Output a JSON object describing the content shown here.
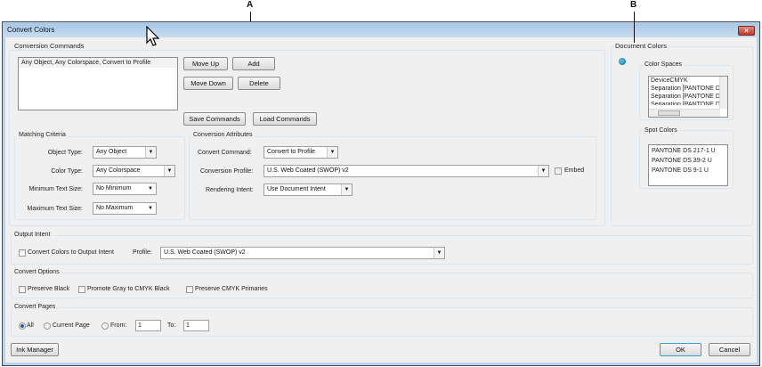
{
  "annotations": {
    "a": "A",
    "b": "B"
  },
  "window": {
    "title": "Convert Colors",
    "close_icon": "×"
  },
  "conversion_commands": {
    "label": "Conversion Commands",
    "list_items": [
      "Any Object, Any Colorspace, Convert to Profile"
    ],
    "move_up": "Move Up",
    "add": "Add",
    "move_down": "Move Down",
    "delete": "Delete",
    "save": "Save Commands",
    "load": "Load Commands"
  },
  "matching_criteria": {
    "label": "Matching Criteria",
    "object_type_label": "Object Type:",
    "object_type": "Any Object",
    "color_type_label": "Color Type:",
    "color_type": "Any Colorspace",
    "min_text_label": "Minimum Text Size:",
    "min_text": "No Minimum",
    "max_text_label": "Maximum Text Size:",
    "max_text": "No Maximum"
  },
  "conversion_attributes": {
    "label": "Conversion Attributes",
    "command_label": "Convert Command:",
    "command": "Convert to Profile",
    "profile_label": "Conversion Profile:",
    "profile": "U.S. Web Coated (SWOP) v2",
    "embed": "Embed",
    "embed_checked": false,
    "intent_label": "Rendering Intent:",
    "intent": "Use Document Intent"
  },
  "document_colors": {
    "label": "Document Colors",
    "color_spaces_label": "Color Spaces",
    "color_spaces": [
      "DeviceCMYK",
      "Separation [PANTONE D",
      "Separation [PANTONE D",
      "Separation [PANTONE D"
    ],
    "spot_colors_label": "Spot Colors",
    "spot_colors": [
      "PANTONE DS 217-1 U",
      "PANTONE DS 39-2 U",
      "PANTONE DS 9-1 U"
    ]
  },
  "output_intent": {
    "label": "Output Intent",
    "convert_label": "Convert Colors to Output Intent",
    "convert_checked": false,
    "profile_label": "Profile:",
    "profile": "U.S. Web Coated (SWOP) v2"
  },
  "convert_options": {
    "label": "Convert Options",
    "preserve_black": "Preserve Black",
    "promote_gray": "Promote Gray to CMYK Black",
    "preserve_primaries": "Preserve CMYK Primaries"
  },
  "convert_pages": {
    "label": "Convert Pages",
    "all": "All",
    "current": "Current Page",
    "from_label": "From:",
    "from": "1",
    "to_label": "To:",
    "to": "1",
    "selected": "All"
  },
  "footer": {
    "ink_manager": "Ink Manager",
    "ok": "OK",
    "cancel": "Cancel"
  }
}
